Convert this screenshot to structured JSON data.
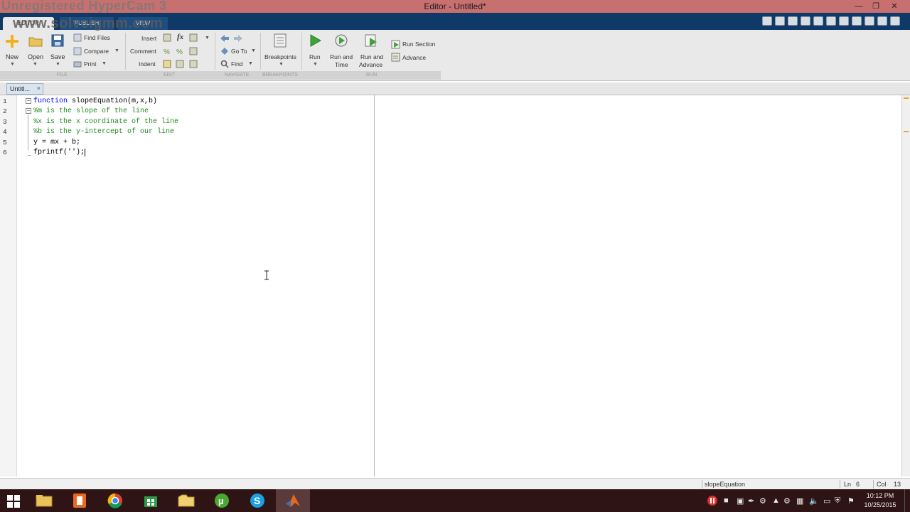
{
  "window": {
    "title": "Editor - Untitled*",
    "watermark_line1": "Unregistered HyperCam 3",
    "watermark_line2": "www.solveigmm.com"
  },
  "ribbon_tabs": [
    "EDITOR",
    "PUBLISH",
    "VIEW"
  ],
  "ribbon": {
    "file": {
      "new": "New",
      "open": "Open",
      "save": "Save",
      "find_files": "Find Files",
      "compare": "Compare",
      "print": "Print",
      "section": "FILE"
    },
    "edit": {
      "insert": "Insert",
      "comment": "Comment",
      "indent": "Indent",
      "fx": "fx",
      "section": "EDIT"
    },
    "navigate": {
      "go_to": "Go To",
      "find": "Find",
      "section": "NAVIGATE"
    },
    "breakpoints": {
      "label": "Breakpoints",
      "section": "BREAKPOINTS"
    },
    "run": {
      "run": "Run",
      "run_and_time_1": "Run and",
      "run_and_time_2": "Time",
      "run_and_advance_1": "Run and",
      "run_and_advance_2": "Advance",
      "run_section": "Run Section",
      "advance": "Advance",
      "section": "RUN"
    }
  },
  "document_tab": {
    "label": "Untitl...",
    "close": "×"
  },
  "line_numbers": [
    "1",
    "2",
    "3",
    "4",
    "5",
    "6"
  ],
  "code": {
    "line1_kw": "function",
    "line1_rest": " slopeEquation(m,x,b)",
    "line2": "%m is the slope of the line",
    "line3": "%x is the x coordinate of the line",
    "line4": "%b is the y-intercept of our line",
    "line5": "y = mx + b;",
    "line6": "fprintf('');"
  },
  "status_bar": {
    "function_name": "slopeEquation",
    "ln_label": "Ln",
    "ln_value": "6",
    "col_label": "Col",
    "col_value": "13"
  },
  "taskbar": {
    "time": "10:12 PM",
    "date": "10/25/2015"
  }
}
